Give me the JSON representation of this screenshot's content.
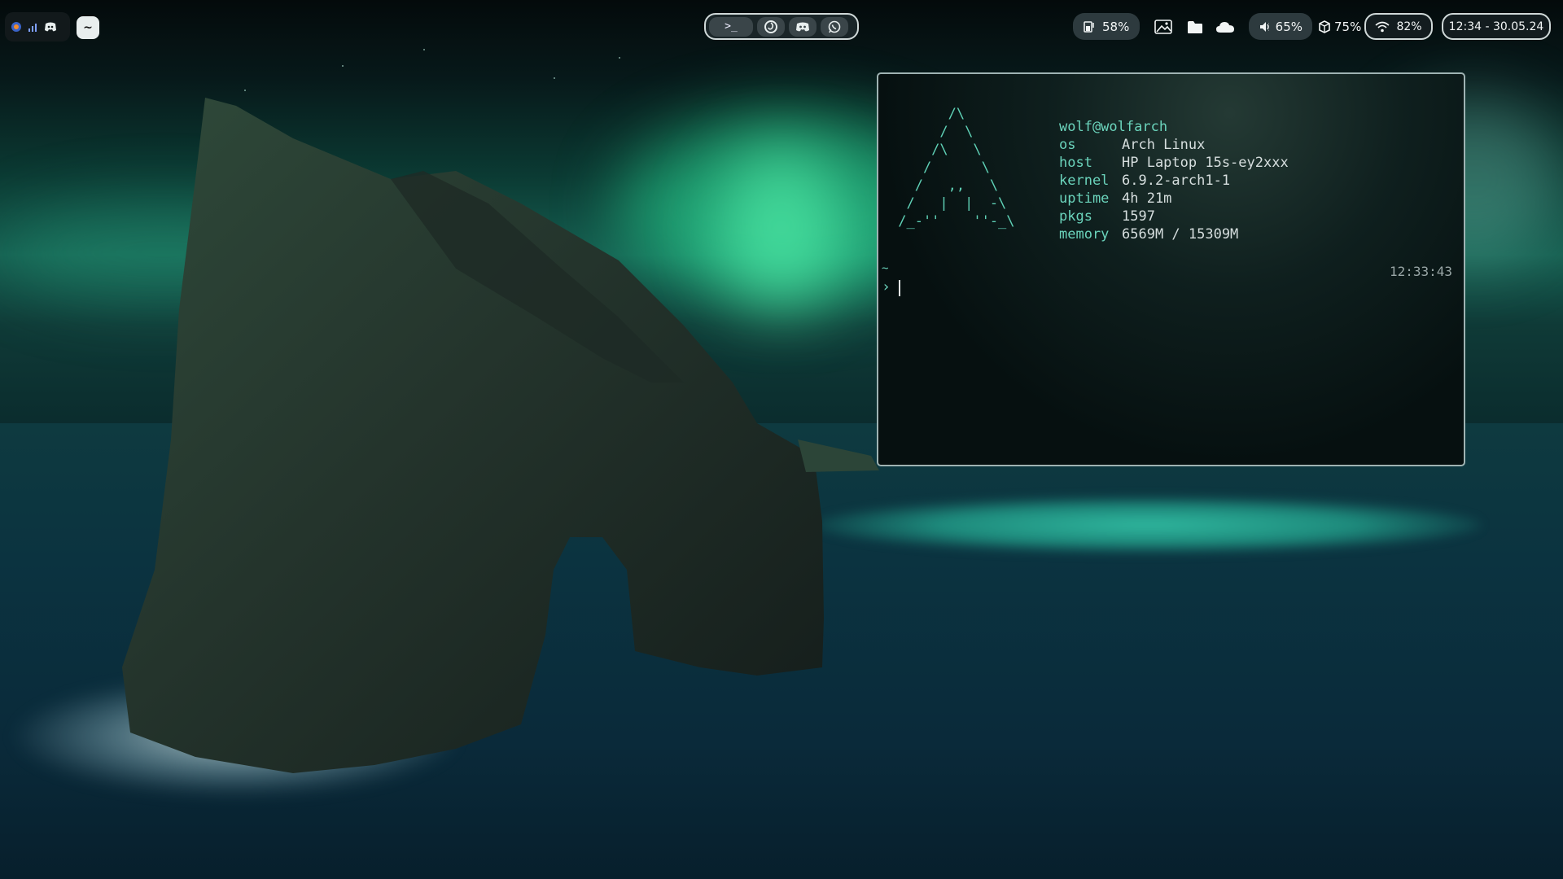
{
  "topbar": {
    "workspaces": {
      "launcher_label": "~"
    },
    "apps": {
      "terminal_label": ">_",
      "items": [
        {
          "name": "firefox",
          "icon": "firefox-icon"
        },
        {
          "name": "discord",
          "icon": "discord-icon"
        },
        {
          "name": "whatsapp",
          "icon": "whatsapp-icon"
        }
      ]
    },
    "status": {
      "brightness": "58%",
      "volume": "65%",
      "battery": "75%",
      "wifi": "82%",
      "datetime": "12:34 - 30.05.24"
    },
    "tray": [
      "image-icon",
      "folder-icon",
      "cloud-icon"
    ]
  },
  "terminal": {
    "ascii_logo": "       /\\\n      /  \\\n     /\\   \\\n    /      \\\n   /   ,,   \\\n  /   |  |  -\\\n /_-''    ''-_\\",
    "user": "wolf@wolfarch",
    "fields": [
      {
        "key": "os",
        "value": "Arch Linux"
      },
      {
        "key": "host",
        "value": "HP Laptop 15s-ey2xxx"
      },
      {
        "key": "kernel",
        "value": "6.9.2-arch1-1"
      },
      {
        "key": "uptime",
        "value": "4h 21m"
      },
      {
        "key": "pkgs",
        "value": "1597"
      },
      {
        "key": "memory",
        "value": "6569M / 15309M"
      }
    ],
    "cwd": "~",
    "prompt_symbol": "›",
    "time": "12:33:43"
  },
  "colors": {
    "accent": "#6bd4bc",
    "bar_border": "#cfd8d8",
    "pill_bg": "#2d3a3e"
  }
}
